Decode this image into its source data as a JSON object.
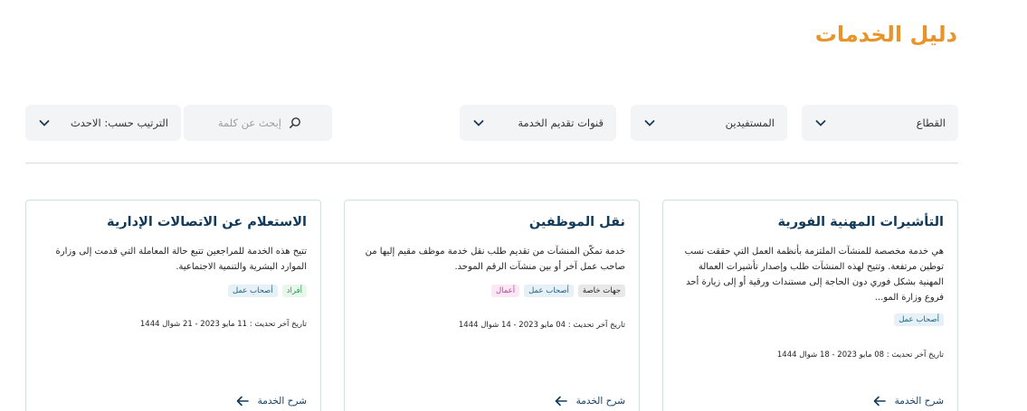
{
  "header": {
    "title": "دليل الخدمات"
  },
  "filters": {
    "sector": "القطاع",
    "beneficiaries": "المستفيدين",
    "channels": "قنوات تقديم الخدمة",
    "search_placeholder": "إبحث عن كلمة",
    "sort": "الترتيب حسب: الاحدث"
  },
  "cards": [
    {
      "title": "التأشيرات المهنية الفورية",
      "description": "هي خدمة مخصصة للمنشآت الملتزمة بأنظمة العمل التي حققت نسب توطين مرتفعة.  وتتيح لهذه المنشآت طلب وإصدار تأشيرات العمالة المهنية بشكل فوري دون الحاجة إلى مستندات ورقية أو إلى زيارة أحد فروع وزارة المو...",
      "tags": [
        "أصحاب عمل"
      ],
      "updated": "تاريخ آخر تحديث : 08 مايو 2023 - 18 شوال 1444",
      "explain": "شرح الخدمة"
    },
    {
      "title": "نقل الموظفين",
      "description": "خدمة تمكّن المنشآت من تقديم طلب نقل خدمة موظف مقيم إليها من صاحب عمل آخر أو بين منشآت الرقم الموحد.",
      "tags": [
        "جهات خاصة",
        "أصحاب عمل",
        "أعمال"
      ],
      "updated": "تاريخ آخر تحديث : 04 مايو 2023 - 14 شوال 1444",
      "explain": "شرح الخدمة"
    },
    {
      "title": "الاستعلام عن الاتصالات الإدارية",
      "description": "تتيح هذه الخدمة للمراجعين تتبع حالة المعاملة التي قدمت إلى وزارة الموارد البشرية والتنمية الاجتماعية.",
      "tags": [
        "أفراد",
        "أصحاب عمل"
      ],
      "updated": "تاريخ آخر تحديث : 11 مايو 2023 - 21 شوال 1444",
      "explain": "شرح الخدمة"
    }
  ],
  "colors": {
    "accent": "#e8942a",
    "title": "#123a5a",
    "border": "#cfe0e6"
  }
}
